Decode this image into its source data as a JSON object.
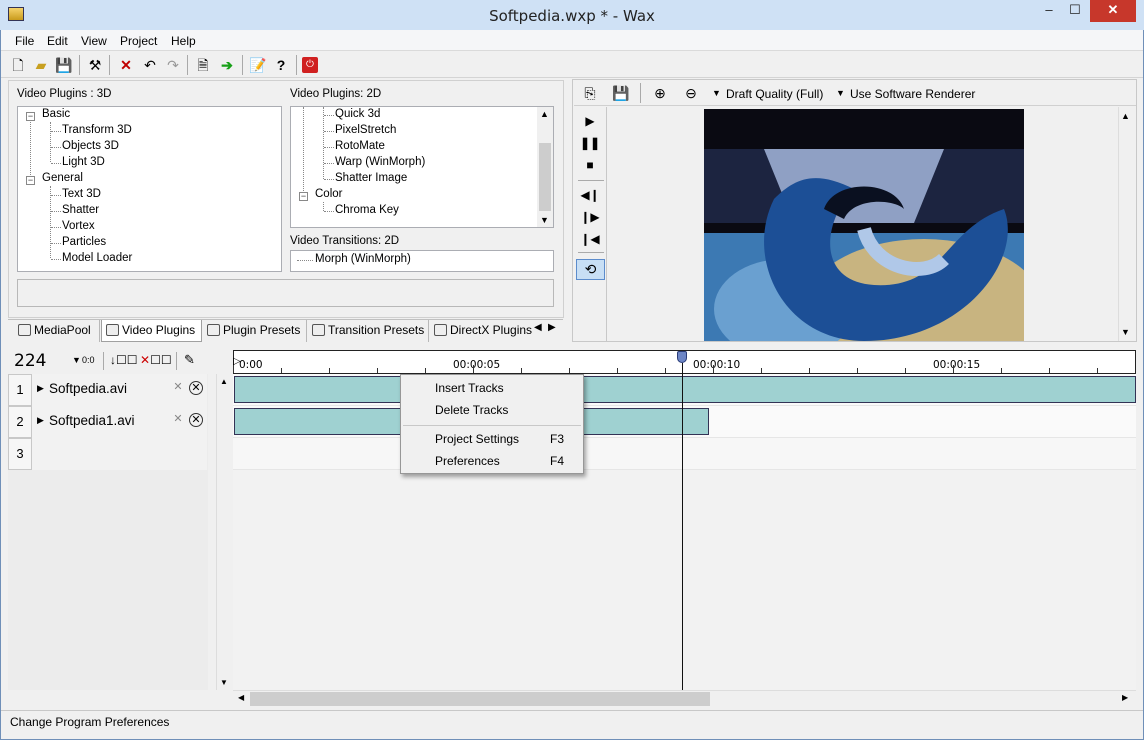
{
  "window": {
    "title": "Softpedia.wxp * - Wax",
    "min_glyph": "–",
    "max_glyph": "☐",
    "close_glyph": "✕"
  },
  "menu": [
    "File",
    "Edit",
    "View",
    "Project",
    "Help"
  ],
  "toolbar_icons": [
    "new-file-icon",
    "open-folder-icon",
    "save-icon",
    "hammer-icon",
    "delete-icon",
    "undo-icon",
    "redo-icon",
    "export-icon",
    "play-green-arrow-icon",
    "properties-icon",
    "help-icon",
    "power-icon"
  ],
  "plugins_3d": {
    "label": "Video Plugins : 3D",
    "groups": [
      {
        "name": "Basic",
        "items": [
          "Transform 3D",
          "Objects 3D",
          "Light 3D"
        ]
      },
      {
        "name": "General",
        "items": [
          "Text 3D",
          "Shatter",
          "Vortex",
          "Particles",
          "Model Loader"
        ]
      }
    ]
  },
  "plugins_2d": {
    "label": "Video Plugins: 2D",
    "items": [
      "Quick 3d",
      "PixelStretch",
      "RotoMate",
      "Warp (WinMorph)",
      "Shatter Image"
    ],
    "group": "Color",
    "group_items": [
      "Chroma Key"
    ]
  },
  "transitions_2d": {
    "label": "Video Transitions: 2D",
    "items": [
      "Morph (WinMorph)"
    ]
  },
  "tabs": [
    "MediaPool",
    "Video Plugins",
    "Plugin Presets",
    "Transition Presets",
    "DirectX Plugins"
  ],
  "active_tab": "Video Plugins",
  "preview": {
    "quality": "Draft Quality (Full)",
    "renderer": "Use Software Renderer"
  },
  "timeline": {
    "counter": "224",
    "zoom_label": "0:0",
    "ticks": [
      "0:00",
      "00:00:05",
      "00:00:10",
      "00:00:15"
    ],
    "tracks": [
      {
        "num": "1",
        "name": "Softpedia.avi"
      },
      {
        "num": "2",
        "name": "Softpedia1.avi"
      },
      {
        "num": "3",
        "name": ""
      }
    ]
  },
  "context_menu": {
    "items": [
      {
        "label": "Insert Tracks",
        "key": ""
      },
      {
        "label": "Delete Tracks",
        "key": ""
      },
      {
        "label": "Project Settings",
        "key": "F3"
      },
      {
        "label": "Preferences",
        "key": "F4"
      }
    ]
  },
  "status": "Change Program Preferences"
}
